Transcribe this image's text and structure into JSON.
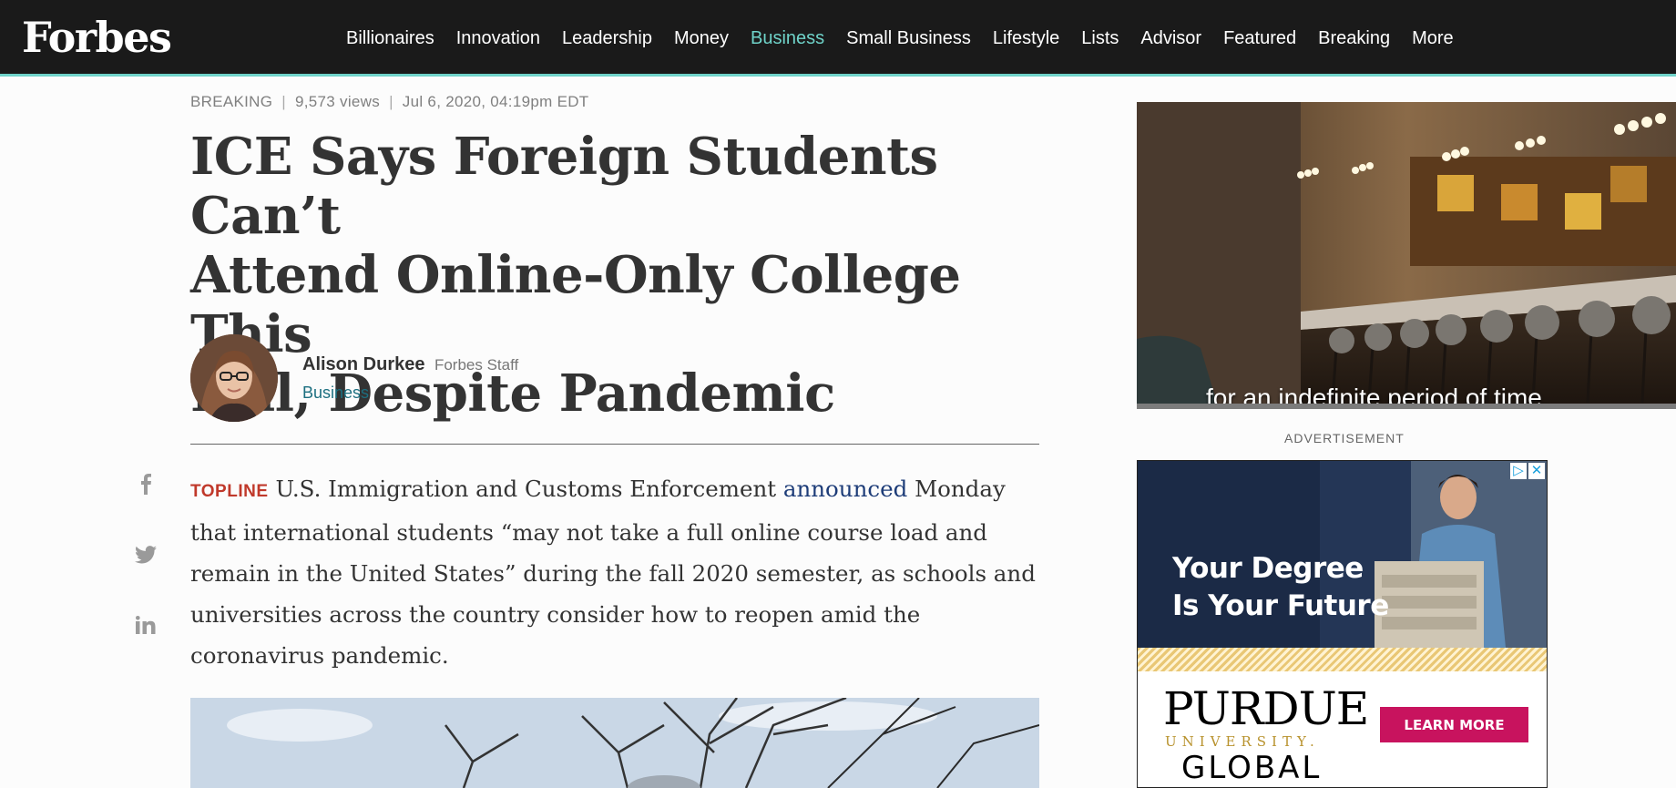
{
  "header": {
    "logo": "Forbes",
    "nav": [
      "Billionaires",
      "Innovation",
      "Leadership",
      "Money",
      "Business",
      "Small Business",
      "Lifestyle",
      "Lists",
      "Advisor",
      "Featured",
      "Breaking",
      "More"
    ],
    "active_nav": "Business"
  },
  "article": {
    "meta": {
      "section": "BREAKING",
      "views": "9,573 views",
      "date": "Jul 6, 2020, 04:19pm EDT"
    },
    "headline_lines": [
      "ICE Says Foreign Students Can’t",
      "Attend Online-Only College This",
      "Fall, Despite Pandemic"
    ],
    "author": {
      "name": "Alison Durkee",
      "role": "Forbes Staff",
      "section": "Business"
    },
    "body": {
      "topline_label": "TOPLINE",
      "text_before_link": "U.S. Immigration and Customs Enforcement",
      "link_text": "announced",
      "text_after_link": "Monday that international students “may not take a full online course load and remain in the United States” during the fall 2020 semester, as schools and universities across the country consider how to reopen amid the coronavirus pandemic."
    },
    "share_icons": [
      "facebook-icon",
      "twitter-icon",
      "linkedin-icon"
    ]
  },
  "rail": {
    "video_caption": "for an indefinite period of time.",
    "ad_label": "ADVERTISEMENT",
    "ad": {
      "headline_lines": [
        "Your Degree",
        "Is Your Future"
      ],
      "brand": "PURDUE",
      "brand_sub": "UNIVERSITY.",
      "brand_global": "GLOBAL",
      "cta": "LEARN MORE"
    }
  },
  "colors": {
    "header_bg": "#1a1a1a",
    "accent": "#6fd3c9",
    "link": "#1d3c78",
    "section_link": "#1c6f80",
    "topline": "#c0392b",
    "ad_cta": "#c8135e"
  }
}
